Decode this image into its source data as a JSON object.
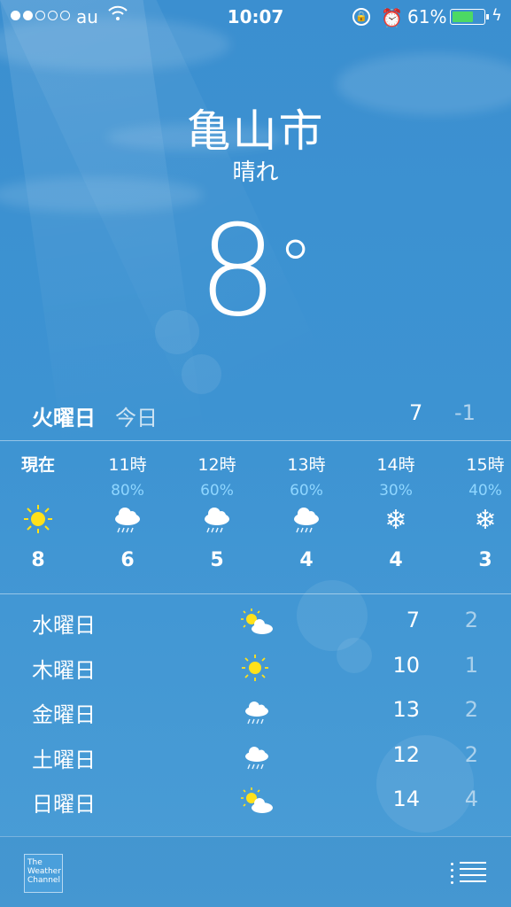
{
  "status_bar": {
    "carrier": "au",
    "time": "10:07",
    "battery_percent": "61%",
    "battery_level": 0.61,
    "signal_bars": 2
  },
  "header": {
    "city": "亀山市",
    "condition": "晴れ",
    "temperature": "8",
    "degree_symbol": "°"
  },
  "today": {
    "day": "火曜日",
    "label": "今日",
    "high": "7",
    "low": "-1"
  },
  "hourly": [
    {
      "time": "現在",
      "pop": "",
      "icon": "sun-icon",
      "temp": "8"
    },
    {
      "time": "11時",
      "pop": "80%",
      "icon": "cloud-rain-icon",
      "temp": "6"
    },
    {
      "time": "12時",
      "pop": "60%",
      "icon": "cloud-rain-icon",
      "temp": "5"
    },
    {
      "time": "13時",
      "pop": "60%",
      "icon": "cloud-rain-icon",
      "temp": "4"
    },
    {
      "time": "14時",
      "pop": "30%",
      "icon": "snowflake-icon",
      "temp": "4"
    },
    {
      "time": "15時",
      "pop": "40%",
      "icon": "snowflake-icon",
      "temp": "3"
    }
  ],
  "daily": [
    {
      "day": "水曜日",
      "icon": "partly-cloudy-icon",
      "high": "7",
      "low": "2"
    },
    {
      "day": "木曜日",
      "icon": "sun-icon",
      "high": "10",
      "low": "1"
    },
    {
      "day": "金曜日",
      "icon": "cloud-rain-icon",
      "high": "13",
      "low": "2"
    },
    {
      "day": "土曜日",
      "icon": "cloud-rain-icon",
      "high": "12",
      "low": "2"
    },
    {
      "day": "日曜日",
      "icon": "partly-cloudy-icon",
      "high": "14",
      "low": "4"
    }
  ],
  "footer": {
    "logo_text": "The Weather Channel"
  },
  "colors": {
    "sky_top": "#3b8fd0",
    "sky_bottom": "#4a9dd6",
    "sun": "#ffe11a",
    "pop": "#8fd6ff",
    "battery": "#4cd964"
  }
}
